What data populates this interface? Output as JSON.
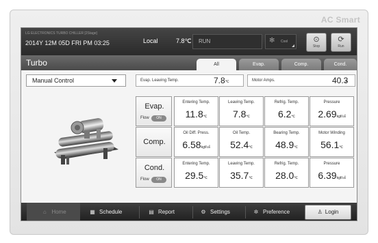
{
  "brand": "AC Smart",
  "status": {
    "device_id": "LG ELECTRONICS TURBO CHILLER [2Stage]",
    "datetime": "2014Y 12M 05D  FRI PM 03:25",
    "mode": "Local",
    "outdoor_temp": "7.8℃",
    "run_state": "RUN",
    "op_mode": "Cool",
    "stop_label": "Stop",
    "run_label": "Run"
  },
  "page": {
    "title": "Turbo",
    "tabs": [
      "All",
      "Evap.",
      "Comp.",
      "Cond."
    ],
    "active_tab": "All"
  },
  "control": {
    "selected": "Manual Control"
  },
  "summary": {
    "evap_leaving": {
      "label": "Evap. Leaving Temp.",
      "value": "7.8",
      "unit": "℃"
    },
    "motor_amps": {
      "label": "Motor Amps.",
      "value": "40.3",
      "unit": "A"
    }
  },
  "groups": {
    "evap": {
      "name": "Evap.",
      "flow_label": "Flow",
      "flow_state": "ON",
      "sensors": [
        {
          "label": "Entering Temp.",
          "value": "11.8",
          "unit": "℃"
        },
        {
          "label": "Leaving Temp.",
          "value": "7.8",
          "unit": "℃"
        },
        {
          "label": "Refrig. Temp.",
          "value": "6.2",
          "unit": "℃"
        },
        {
          "label": "Pressure",
          "value": "2.69",
          "unit": "kgf/㎠"
        }
      ]
    },
    "comp": {
      "name": "Comp.",
      "sensors": [
        {
          "label": "Oil Diff. Press.",
          "value": "6.58",
          "unit": "kgf/㎠"
        },
        {
          "label": "Oil Temp.",
          "value": "52.4",
          "unit": "℃"
        },
        {
          "label": "Bearing Temp.",
          "value": "48.9",
          "unit": "℃"
        },
        {
          "label": "Motor Winding",
          "value": "56.1",
          "unit": "℃"
        }
      ]
    },
    "cond": {
      "name": "Cond.",
      "flow_label": "Flow",
      "flow_state": "ON",
      "sensors": [
        {
          "label": "Entering Temp.",
          "value": "29.5",
          "unit": "℃"
        },
        {
          "label": "Leaving Temp.",
          "value": "35.7",
          "unit": "℃"
        },
        {
          "label": "Refrig. Temp.",
          "value": "28.0",
          "unit": "℃"
        },
        {
          "label": "Pressure",
          "value": "6.39",
          "unit": "kgf/㎠"
        }
      ]
    }
  },
  "nav": {
    "home": "Home",
    "schedule": "Schedule",
    "report": "Report",
    "settings": "Settings",
    "preference": "Preference",
    "login": "Login"
  },
  "icons": {
    "home": "home-icon",
    "schedule": "calendar-icon",
    "report": "report-icon",
    "settings": "settings-icon",
    "preference": "gear-icon",
    "login": "user-icon",
    "stop": "stop-icon",
    "run": "run-icon",
    "cool": "snowflake-icon"
  },
  "colors": {
    "topbar": "#2a2a2a",
    "title_bar": "#5a5a5a",
    "toggle_on": "#888888"
  }
}
